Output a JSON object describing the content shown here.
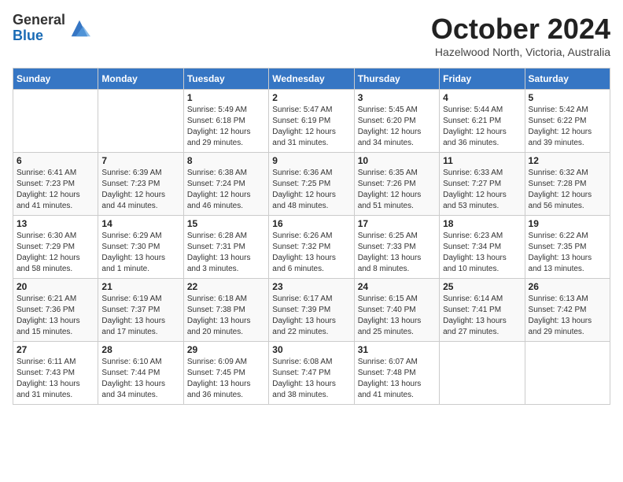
{
  "header": {
    "logo_general": "General",
    "logo_blue": "Blue",
    "month_title": "October 2024",
    "location": "Hazelwood North, Victoria, Australia"
  },
  "days_of_week": [
    "Sunday",
    "Monday",
    "Tuesday",
    "Wednesday",
    "Thursday",
    "Friday",
    "Saturday"
  ],
  "weeks": [
    [
      {
        "day": "",
        "info": ""
      },
      {
        "day": "",
        "info": ""
      },
      {
        "day": "1",
        "info": "Sunrise: 5:49 AM\nSunset: 6:18 PM\nDaylight: 12 hours and 29 minutes."
      },
      {
        "day": "2",
        "info": "Sunrise: 5:47 AM\nSunset: 6:19 PM\nDaylight: 12 hours and 31 minutes."
      },
      {
        "day": "3",
        "info": "Sunrise: 5:45 AM\nSunset: 6:20 PM\nDaylight: 12 hours and 34 minutes."
      },
      {
        "day": "4",
        "info": "Sunrise: 5:44 AM\nSunset: 6:21 PM\nDaylight: 12 hours and 36 minutes."
      },
      {
        "day": "5",
        "info": "Sunrise: 5:42 AM\nSunset: 6:22 PM\nDaylight: 12 hours and 39 minutes."
      }
    ],
    [
      {
        "day": "6",
        "info": "Sunrise: 6:41 AM\nSunset: 7:23 PM\nDaylight: 12 hours and 41 minutes."
      },
      {
        "day": "7",
        "info": "Sunrise: 6:39 AM\nSunset: 7:23 PM\nDaylight: 12 hours and 44 minutes."
      },
      {
        "day": "8",
        "info": "Sunrise: 6:38 AM\nSunset: 7:24 PM\nDaylight: 12 hours and 46 minutes."
      },
      {
        "day": "9",
        "info": "Sunrise: 6:36 AM\nSunset: 7:25 PM\nDaylight: 12 hours and 48 minutes."
      },
      {
        "day": "10",
        "info": "Sunrise: 6:35 AM\nSunset: 7:26 PM\nDaylight: 12 hours and 51 minutes."
      },
      {
        "day": "11",
        "info": "Sunrise: 6:33 AM\nSunset: 7:27 PM\nDaylight: 12 hours and 53 minutes."
      },
      {
        "day": "12",
        "info": "Sunrise: 6:32 AM\nSunset: 7:28 PM\nDaylight: 12 hours and 56 minutes."
      }
    ],
    [
      {
        "day": "13",
        "info": "Sunrise: 6:30 AM\nSunset: 7:29 PM\nDaylight: 12 hours and 58 minutes."
      },
      {
        "day": "14",
        "info": "Sunrise: 6:29 AM\nSunset: 7:30 PM\nDaylight: 13 hours and 1 minute."
      },
      {
        "day": "15",
        "info": "Sunrise: 6:28 AM\nSunset: 7:31 PM\nDaylight: 13 hours and 3 minutes."
      },
      {
        "day": "16",
        "info": "Sunrise: 6:26 AM\nSunset: 7:32 PM\nDaylight: 13 hours and 6 minutes."
      },
      {
        "day": "17",
        "info": "Sunrise: 6:25 AM\nSunset: 7:33 PM\nDaylight: 13 hours and 8 minutes."
      },
      {
        "day": "18",
        "info": "Sunrise: 6:23 AM\nSunset: 7:34 PM\nDaylight: 13 hours and 10 minutes."
      },
      {
        "day": "19",
        "info": "Sunrise: 6:22 AM\nSunset: 7:35 PM\nDaylight: 13 hours and 13 minutes."
      }
    ],
    [
      {
        "day": "20",
        "info": "Sunrise: 6:21 AM\nSunset: 7:36 PM\nDaylight: 13 hours and 15 minutes."
      },
      {
        "day": "21",
        "info": "Sunrise: 6:19 AM\nSunset: 7:37 PM\nDaylight: 13 hours and 17 minutes."
      },
      {
        "day": "22",
        "info": "Sunrise: 6:18 AM\nSunset: 7:38 PM\nDaylight: 13 hours and 20 minutes."
      },
      {
        "day": "23",
        "info": "Sunrise: 6:17 AM\nSunset: 7:39 PM\nDaylight: 13 hours and 22 minutes."
      },
      {
        "day": "24",
        "info": "Sunrise: 6:15 AM\nSunset: 7:40 PM\nDaylight: 13 hours and 25 minutes."
      },
      {
        "day": "25",
        "info": "Sunrise: 6:14 AM\nSunset: 7:41 PM\nDaylight: 13 hours and 27 minutes."
      },
      {
        "day": "26",
        "info": "Sunrise: 6:13 AM\nSunset: 7:42 PM\nDaylight: 13 hours and 29 minutes."
      }
    ],
    [
      {
        "day": "27",
        "info": "Sunrise: 6:11 AM\nSunset: 7:43 PM\nDaylight: 13 hours and 31 minutes."
      },
      {
        "day": "28",
        "info": "Sunrise: 6:10 AM\nSunset: 7:44 PM\nDaylight: 13 hours and 34 minutes."
      },
      {
        "day": "29",
        "info": "Sunrise: 6:09 AM\nSunset: 7:45 PM\nDaylight: 13 hours and 36 minutes."
      },
      {
        "day": "30",
        "info": "Sunrise: 6:08 AM\nSunset: 7:47 PM\nDaylight: 13 hours and 38 minutes."
      },
      {
        "day": "31",
        "info": "Sunrise: 6:07 AM\nSunset: 7:48 PM\nDaylight: 13 hours and 41 minutes."
      },
      {
        "day": "",
        "info": ""
      },
      {
        "day": "",
        "info": ""
      }
    ]
  ]
}
